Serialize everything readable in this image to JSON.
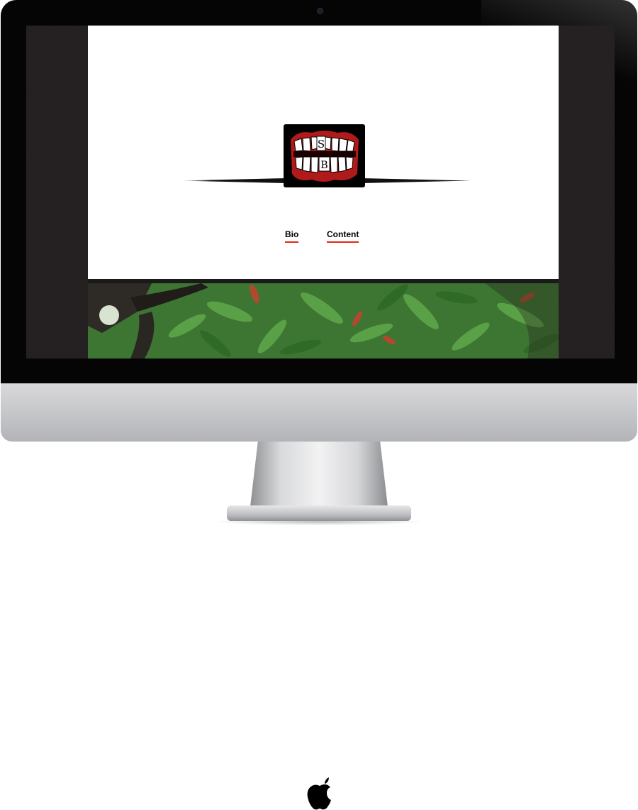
{
  "device": {
    "name": "iMac"
  },
  "site": {
    "logo": {
      "letters": [
        "S",
        "B"
      ],
      "icon": "teeth-mouth-logo"
    },
    "nav": {
      "items": [
        {
          "label": "Bio"
        },
        {
          "label": "Content"
        }
      ]
    },
    "hero": {
      "subject": "leafy-tree-branches"
    }
  },
  "colors": {
    "accent": "#e0281b",
    "screen_background": "#231f20",
    "page_background": "#ffffff",
    "logo_background": "#000000",
    "gum_red": "#b01a1a"
  }
}
